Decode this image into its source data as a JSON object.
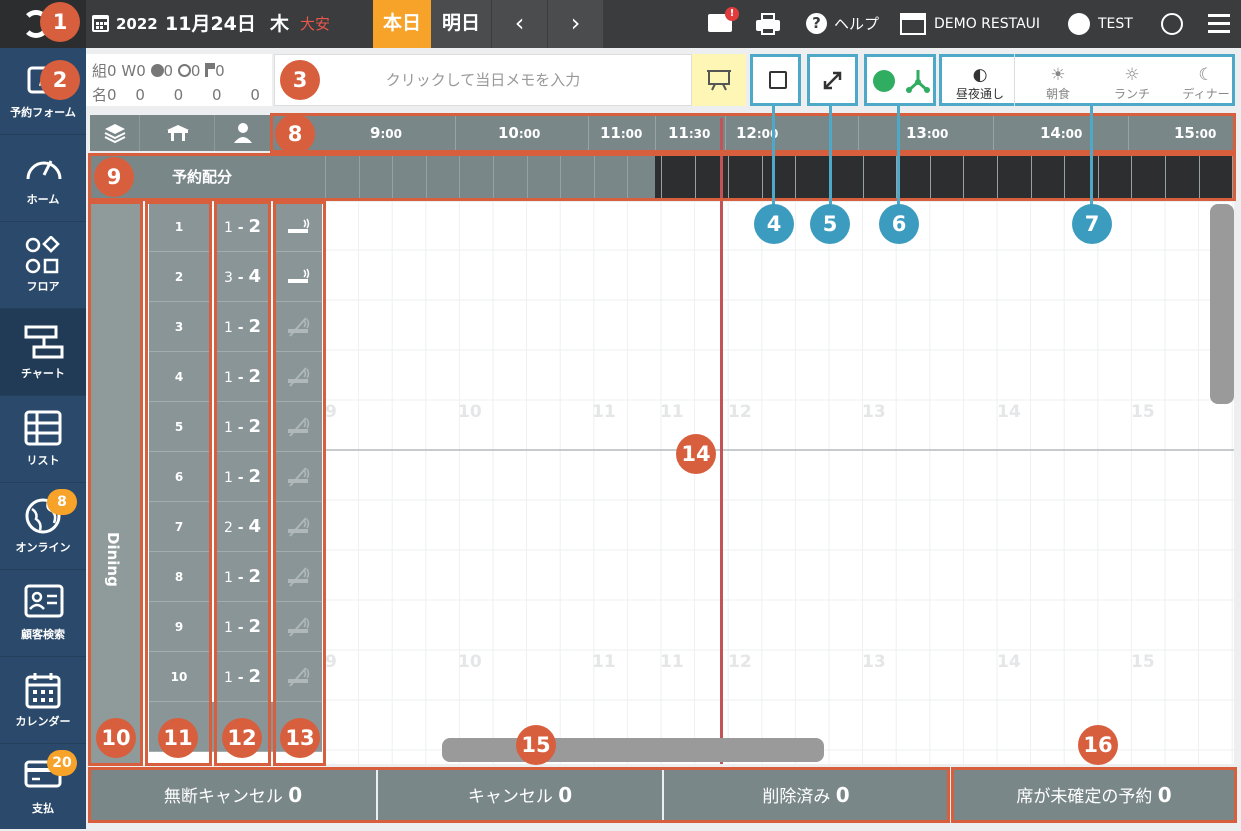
{
  "topbar": {
    "year": "2022",
    "date": "11月24日",
    "weekday": "木",
    "rokuyo": "大安",
    "today_label": "本日",
    "tomorrow_label": "明日",
    "prev_icon": "chevron-left-icon",
    "next_icon": "chevron-right-icon",
    "mail_badge": "!",
    "help_label": "ヘルプ",
    "restaurant_label": "DEMO RESTAUI",
    "user_label": "TEST"
  },
  "sidebar": {
    "items": [
      {
        "label": "予約フォーム",
        "icon": "edit-icon"
      },
      {
        "label": "ホーム",
        "icon": "gauge-icon"
      },
      {
        "label": "フロア",
        "icon": "shapes-icon"
      },
      {
        "label": "チャート",
        "icon": "chart-icon"
      },
      {
        "label": "リスト",
        "icon": "list-icon"
      },
      {
        "label": "オンライン",
        "icon": "globe-icon",
        "badge": "8"
      },
      {
        "label": "顧客検索",
        "icon": "id-card-icon"
      },
      {
        "label": "カレンダー",
        "icon": "calendar-icon"
      },
      {
        "label": "支払",
        "icon": "credit-card-icon",
        "badge": "20"
      }
    ]
  },
  "counts": {
    "row1": [
      "組",
      "0",
      "W",
      "0",
      "0",
      "0",
      "0"
    ],
    "row2": [
      "名",
      "0",
      "0",
      "0",
      "0",
      "0"
    ]
  },
  "memo": {
    "placeholder": "クリックして当日メモを入力"
  },
  "modes": {
    "items": [
      {
        "label": "昼夜通し",
        "icon": "half-circle-icon"
      },
      {
        "label": "朝食",
        "icon": "sunrise-icon"
      },
      {
        "label": "ランチ",
        "icon": "sun-icon"
      },
      {
        "label": "ディナー",
        "icon": "moon-icon"
      }
    ]
  },
  "timeline": {
    "labels": [
      {
        "h": "9",
        "m": ":00"
      },
      {
        "h": "10",
        "m": ":00"
      },
      {
        "h": "11",
        "m": ":00"
      },
      {
        "h": "11",
        "m": ":30"
      },
      {
        "h": "12",
        "m": ":00"
      },
      {
        "h": "13",
        "m": ":00"
      },
      {
        "h": "14",
        "m": ":00"
      },
      {
        "h": "15",
        "m": ":00"
      }
    ],
    "ghost": [
      "9",
      "10",
      "11",
      "11",
      "12",
      "13",
      "14",
      "15"
    ]
  },
  "alloc_label": "予約配分",
  "area_label": "Dining",
  "tables": [
    {
      "no": "1",
      "cap_min": "1",
      "cap_max": "2",
      "smoking": true
    },
    {
      "no": "2",
      "cap_min": "3",
      "cap_max": "4",
      "smoking": true
    },
    {
      "no": "3",
      "cap_min": "1",
      "cap_max": "2",
      "smoking": false
    },
    {
      "no": "4",
      "cap_min": "1",
      "cap_max": "2",
      "smoking": false
    },
    {
      "no": "5",
      "cap_min": "1",
      "cap_max": "2",
      "smoking": false
    },
    {
      "no": "6",
      "cap_min": "1",
      "cap_max": "2",
      "smoking": false
    },
    {
      "no": "7",
      "cap_min": "2",
      "cap_max": "4",
      "smoking": false
    },
    {
      "no": "8",
      "cap_min": "1",
      "cap_max": "2",
      "smoking": false
    },
    {
      "no": "9",
      "cap_min": "1",
      "cap_max": "2",
      "smoking": false
    },
    {
      "no": "10",
      "cap_min": "1",
      "cap_max": "2",
      "smoking": false
    }
  ],
  "footer": {
    "noshow_label": "無断キャンセル",
    "noshow_count": "0",
    "cancel_label": "キャンセル",
    "cancel_count": "0",
    "deleted_label": "削除済み",
    "deleted_count": "0",
    "unassigned_label": "席が未確定の予約",
    "unassigned_count": "0"
  },
  "callouts": [
    "1",
    "2",
    "3",
    "4",
    "5",
    "6",
    "7",
    "8",
    "9",
    "10",
    "11",
    "12",
    "13",
    "14",
    "15",
    "16"
  ],
  "colors": {
    "accent": "#f7a229",
    "callout_red": "#d85f3d",
    "callout_blue": "#3c9cc0",
    "sidebar": "#2b4a6b",
    "now_line": "#c25356"
  }
}
